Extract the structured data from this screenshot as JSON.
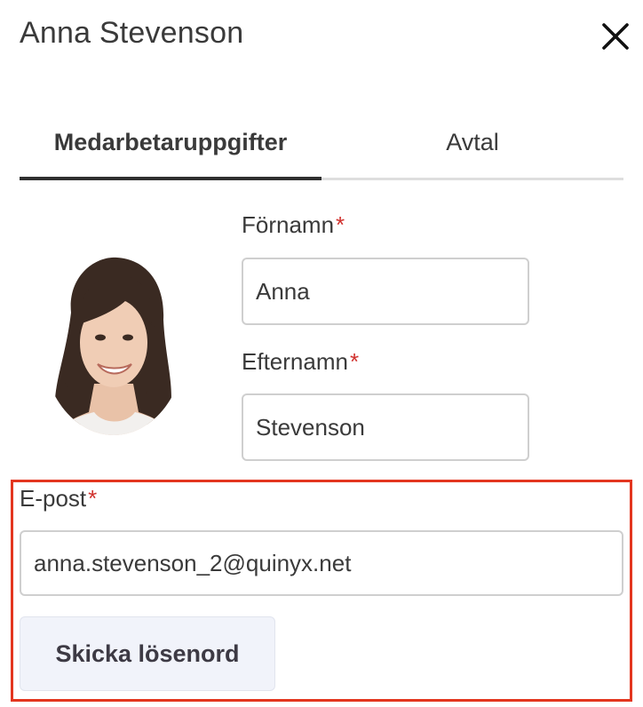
{
  "dialog": {
    "title": "Anna Stevenson"
  },
  "tabs": [
    {
      "label": "Medarbetaruppgifter",
      "active": true
    },
    {
      "label": "Avtal",
      "active": false
    }
  ],
  "form": {
    "first_name": {
      "label": "Förnamn",
      "required_mark": "*",
      "value": "Anna"
    },
    "last_name": {
      "label": "Efternamn",
      "required_mark": "*",
      "value": "Stevenson"
    },
    "email": {
      "label": "E-post",
      "required_mark": "*",
      "value": "anna.stevenson_2@quinyx.net"
    },
    "send_password_label": "Skicka lösenord"
  },
  "icons": {
    "close": "close-icon"
  },
  "colors": {
    "required": "#d0312d",
    "highlight_border": "#e3361f",
    "active_tab_underline": "#2f2f2f",
    "button_background": "#f1f3fa"
  }
}
